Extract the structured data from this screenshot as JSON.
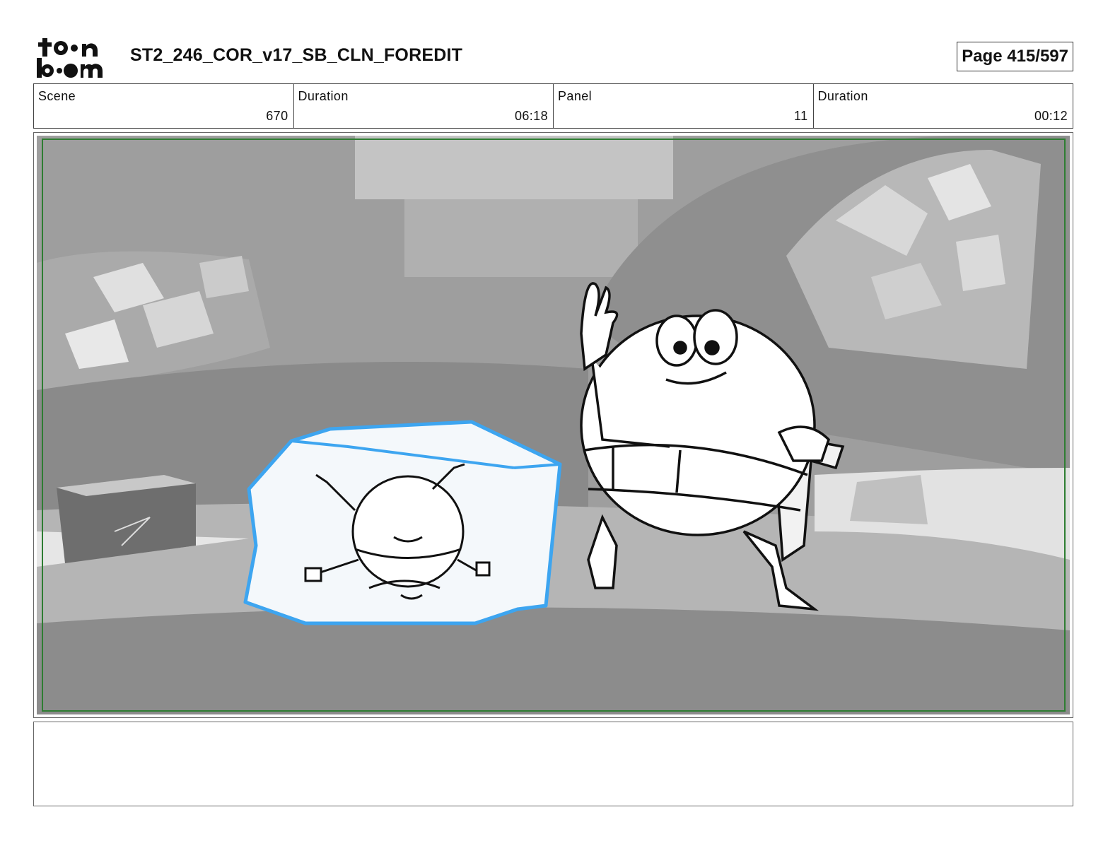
{
  "header": {
    "logo_text": "toon boom",
    "title": "ST2_246_COR_v17_SB_CLN_FOREDIT",
    "page": "Page 415/597"
  },
  "info": {
    "scene_label": "Scene",
    "scene_value": "670",
    "scene_duration_label": "Duration",
    "scene_duration_value": "06:18",
    "panel_label": "Panel",
    "panel_value": "11",
    "panel_duration_label": "Duration",
    "panel_duration_value": "00:12"
  },
  "panel": {
    "description": "",
    "safe_frame_color": "#2e7d32",
    "ice_outline_color": "#3da5f0"
  },
  "notes": {
    "text": ""
  }
}
